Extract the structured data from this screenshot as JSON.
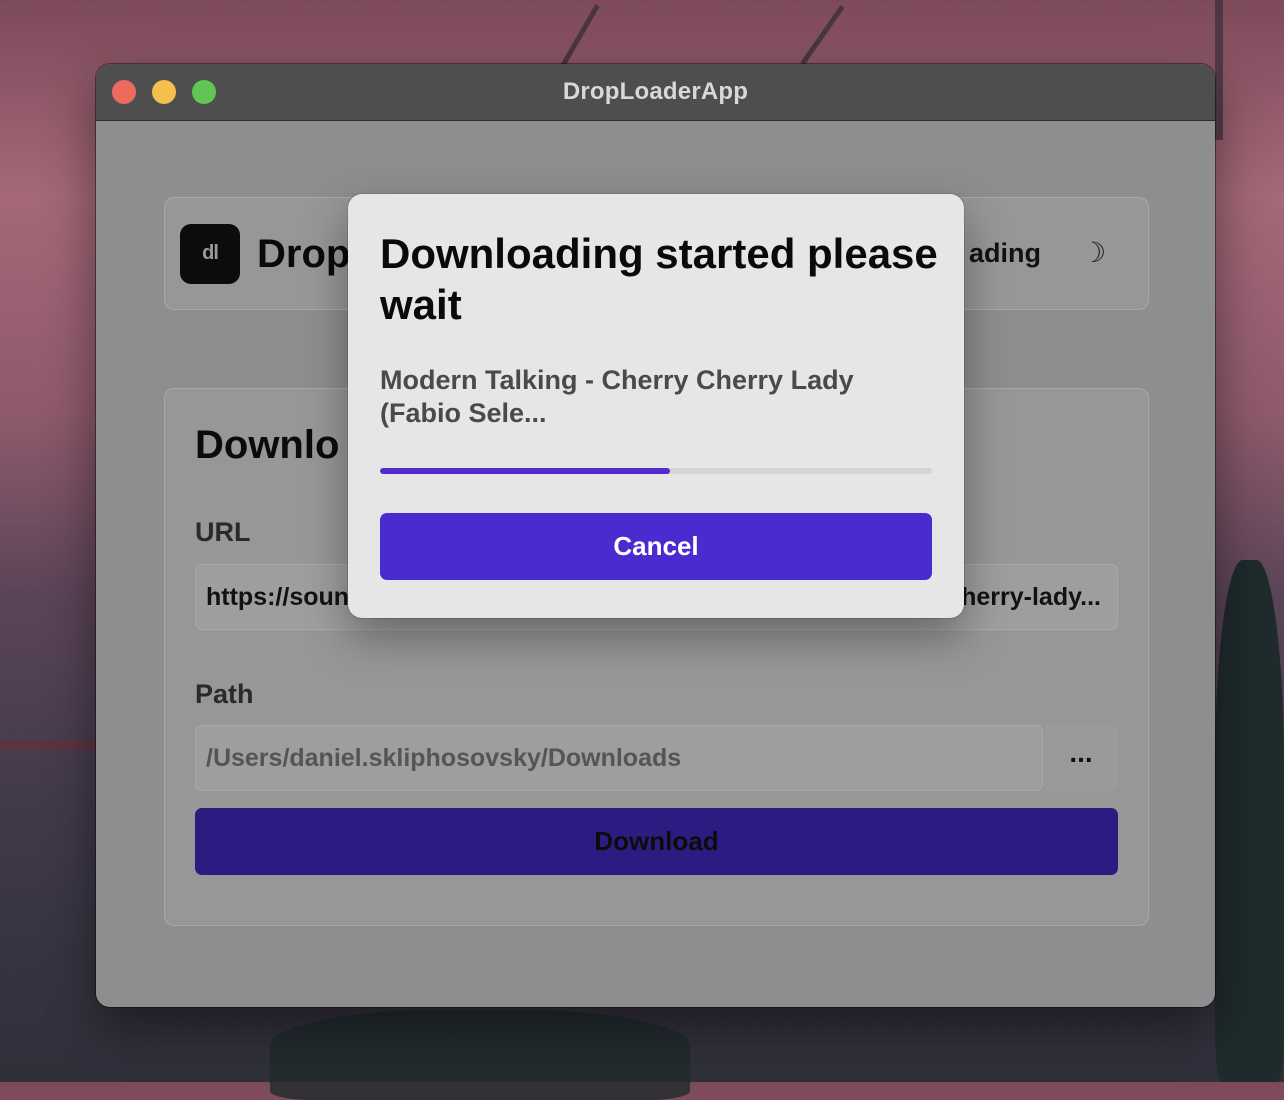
{
  "window": {
    "title": "DropLoaderApp"
  },
  "header": {
    "logo_text": "dl",
    "app_name_visible": "Drop",
    "status_visible": "ading",
    "theme_toggle_glyph": "☽",
    "theme_toggle_icon": "moon-icon"
  },
  "form": {
    "title_visible": "Downlo",
    "url_label": "URL",
    "url_value_left": "https://soun",
    "url_value_right": "herry-lady...",
    "path_label": "Path",
    "path_value": "/Users/daniel.skliphosovsky/Downloads",
    "browse_label": "...",
    "download_label": "Download"
  },
  "modal": {
    "title": "Downloading started please wait",
    "track_name": "Modern Talking - Cherry Cherry Lady (Fabio Sele...",
    "progress_fraction": 0.525,
    "cancel_label": "Cancel"
  },
  "colors": {
    "accent": "#4a2bd0",
    "close": "#ed6a5e",
    "minimize": "#f5bf4f",
    "maximize": "#61c554"
  }
}
